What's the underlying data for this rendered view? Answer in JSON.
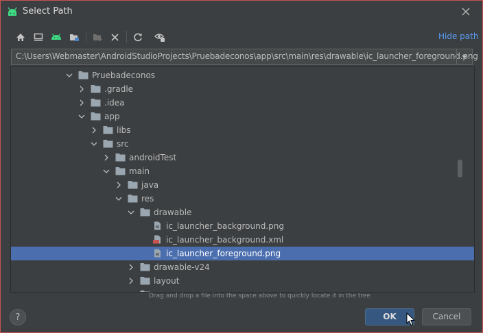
{
  "window": {
    "title": "Select Path",
    "accent_color": "#589df6",
    "selection_color": "#4b6eaf",
    "border_color": "#c75450"
  },
  "toolbar": {
    "hide_path_label": "Hide path",
    "buttons": [
      {
        "icon": "home-icon"
      },
      {
        "icon": "desktop-icon"
      },
      {
        "icon": "android-icon"
      },
      {
        "icon": "project-folder-icon"
      },
      {
        "icon": "new-folder-icon"
      },
      {
        "icon": "delete-icon"
      },
      {
        "icon": "refresh-icon"
      },
      {
        "icon": "show-hidden-icon"
      }
    ]
  },
  "path": {
    "value": "C:\\Users\\Webmaster\\AndroidStudioProjects\\Pruebadeconos\\app\\src\\main\\res\\drawable\\ic_launcher_foreground.png"
  },
  "tree": {
    "rows": [
      {
        "label": "Pruebadeconos",
        "type": "folder",
        "expanded": true
      },
      {
        "label": ".gradle",
        "type": "folder",
        "expanded": false
      },
      {
        "label": ".idea",
        "type": "folder",
        "expanded": false
      },
      {
        "label": "app",
        "type": "folder",
        "expanded": true
      },
      {
        "label": "libs",
        "type": "folder",
        "expanded": false
      },
      {
        "label": "src",
        "type": "folder",
        "expanded": true
      },
      {
        "label": "androidTest",
        "type": "folder",
        "expanded": false
      },
      {
        "label": "main",
        "type": "folder",
        "expanded": true
      },
      {
        "label": "java",
        "type": "folder",
        "expanded": false
      },
      {
        "label": "res",
        "type": "folder",
        "expanded": true
      },
      {
        "label": "drawable",
        "type": "folder",
        "expanded": true
      },
      {
        "label": "ic_launcher_background.png",
        "type": "image"
      },
      {
        "label": "ic_launcher_background.xml",
        "type": "xml"
      },
      {
        "label": "ic_launcher_foreground.png",
        "type": "image",
        "selected": true
      },
      {
        "label": "drawable-v24",
        "type": "folder",
        "expanded": false
      },
      {
        "label": "layout",
        "type": "folder",
        "expanded": false
      }
    ]
  },
  "hint": "Drag and drop a file into the space above to quickly locate it in the tree",
  "footer": {
    "help_label": "?",
    "ok_label": "OK",
    "cancel_label": "Cancel"
  }
}
